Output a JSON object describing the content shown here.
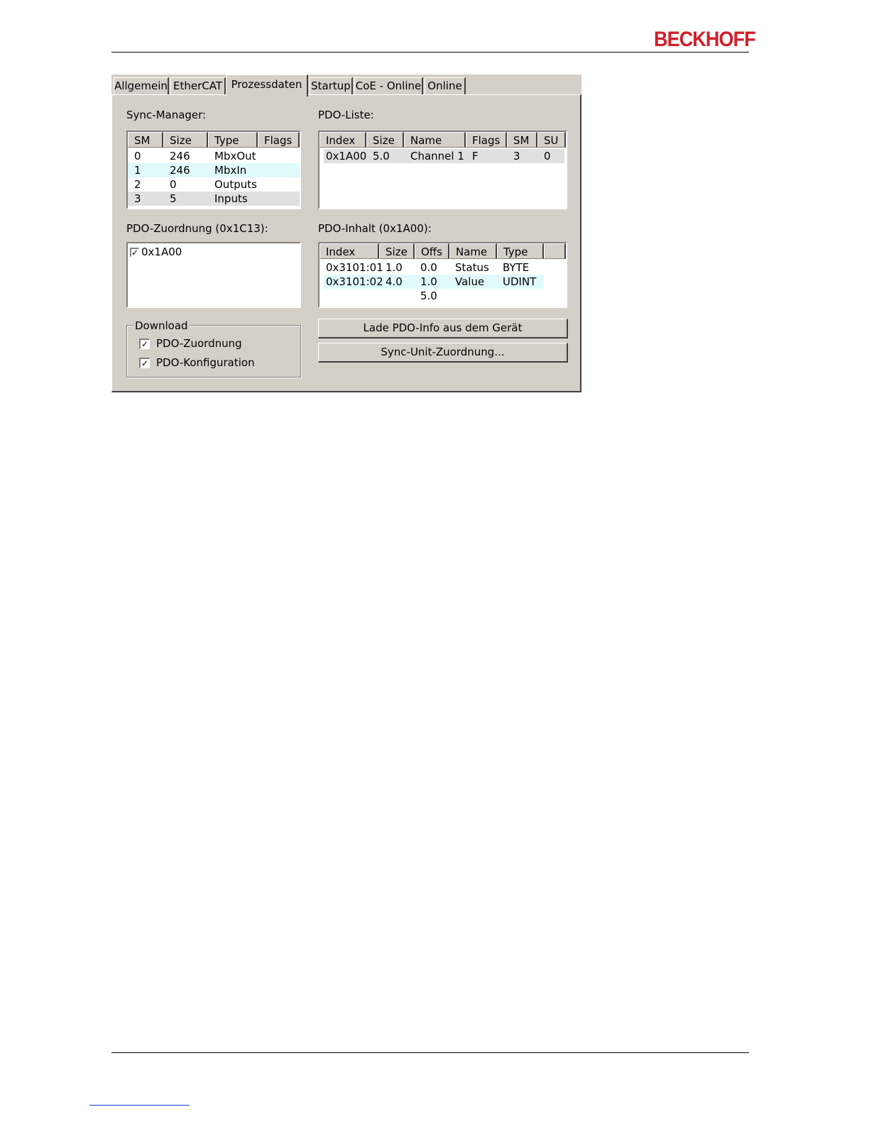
{
  "header": {
    "logo": "BECKHOFF"
  },
  "tabs": [
    {
      "label": "Allgemein"
    },
    {
      "label": "EtherCAT"
    },
    {
      "label": "Prozessdaten"
    },
    {
      "label": "Startup"
    },
    {
      "label": "CoE - Online"
    },
    {
      "label": "Online"
    }
  ],
  "active_tab": "Prozessdaten",
  "sync_manager": {
    "label": "Sync-Manager:",
    "columns": [
      "SM",
      "Size",
      "Type",
      "Flags"
    ],
    "rows": [
      {
        "sm": "0",
        "size": "246",
        "type": "MbxOut",
        "flags": ""
      },
      {
        "sm": "1",
        "size": "246",
        "type": "MbxIn",
        "flags": ""
      },
      {
        "sm": "2",
        "size": "0",
        "type": "Outputs",
        "flags": ""
      },
      {
        "sm": "3",
        "size": "5",
        "type": "Inputs",
        "flags": ""
      }
    ]
  },
  "pdo_liste": {
    "label": "PDO-Liste:",
    "columns": [
      "Index",
      "Size",
      "Name",
      "Flags",
      "SM",
      "SU"
    ],
    "rows": [
      {
        "index": "0x1A00",
        "size": "5.0",
        "name": "Channel 1",
        "flags": "F",
        "sm": "3",
        "su": "0"
      }
    ]
  },
  "pdo_zuordnung": {
    "label": "PDO-Zuordnung (0x1C13):",
    "items": [
      {
        "label": "0x1A00",
        "checked": true
      }
    ]
  },
  "pdo_inhalt": {
    "label": "PDO-Inhalt (0x1A00):",
    "columns": [
      "Index",
      "Size",
      "Offs",
      "Name",
      "Type"
    ],
    "rows": [
      {
        "index": "0x3101:01",
        "size": "1.0",
        "offs": "0.0",
        "name": "Status",
        "type": "BYTE"
      },
      {
        "index": "0x3101:02",
        "size": "4.0",
        "offs": "1.0",
        "name": "Value",
        "type": "UDINT"
      },
      {
        "index": "",
        "size": "",
        "offs": "5.0",
        "name": "",
        "type": ""
      }
    ]
  },
  "download": {
    "title": "Download",
    "options": [
      {
        "label": "PDO-Zuordnung",
        "checked": true
      },
      {
        "label": "PDO-Konfiguration",
        "checked": true
      }
    ]
  },
  "buttons": {
    "load_pdo_info": "Lade PDO-Info aus dem Gerät",
    "sync_unit": "Sync-Unit-Zuordnung..."
  },
  "colors": {
    "logo": "#d0202a",
    "dialog_bg": "#d4d0c8",
    "row_highlight": "#e0fafc"
  },
  "check_mark": "✓"
}
